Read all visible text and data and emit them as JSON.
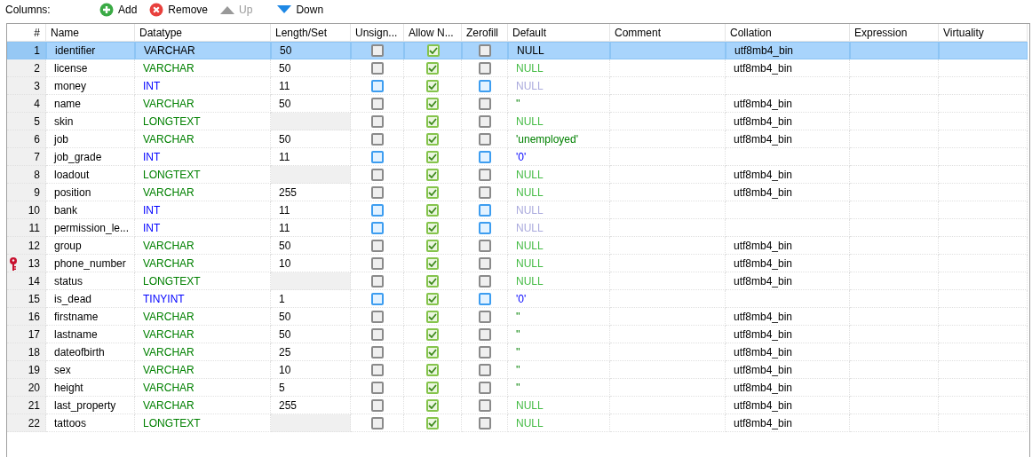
{
  "toolbar": {
    "label": "Columns:",
    "buttons": [
      {
        "kind": "add",
        "label": "Add",
        "disabled": false
      },
      {
        "kind": "remove",
        "label": "Remove",
        "disabled": false
      },
      {
        "kind": "up",
        "label": "Up",
        "disabled": true
      },
      {
        "kind": "down",
        "label": "Down",
        "disabled": false
      }
    ]
  },
  "table": {
    "columns": [
      "#",
      "Name",
      "Datatype",
      "Length/Set",
      "Unsign...",
      "Allow N...",
      "Zerofill",
      "Default",
      "Comment",
      "Collation",
      "Expression",
      "Virtuality"
    ],
    "rows": [
      {
        "num": "1",
        "name": "identifier",
        "datatype": {
          "text": "VARCHAR",
          "kind": "string"
        },
        "length": "50",
        "unsigned": false,
        "allow_null": true,
        "zerofill": false,
        "default": {
          "text": "NULL",
          "kind": "null"
        },
        "collation": "utf8mb4_bin",
        "key": false,
        "selected": true
      },
      {
        "num": "2",
        "name": "license",
        "datatype": {
          "text": "VARCHAR",
          "kind": "string"
        },
        "length": "50",
        "unsigned": false,
        "allow_null": true,
        "zerofill": false,
        "default": {
          "text": "NULL",
          "kind": "null"
        },
        "collation": "utf8mb4_bin",
        "key": false,
        "selected": false
      },
      {
        "num": "3",
        "name": "money",
        "datatype": {
          "text": "INT",
          "kind": "numeric"
        },
        "length": "11",
        "unsigned": false,
        "allow_null": true,
        "zerofill": false,
        "default": {
          "text": "NULL",
          "kind": "null"
        },
        "key": false,
        "selected": false
      },
      {
        "num": "4",
        "name": "name",
        "datatype": {
          "text": "VARCHAR",
          "kind": "string"
        },
        "length": "50",
        "unsigned": false,
        "allow_null": true,
        "zerofill": false,
        "default": {
          "text": "''",
          "kind": "value"
        },
        "collation": "utf8mb4_bin",
        "key": false,
        "selected": false
      },
      {
        "num": "5",
        "name": "skin",
        "datatype": {
          "text": "LONGTEXT",
          "kind": "string"
        },
        "unsigned": false,
        "allow_null": true,
        "zerofill": false,
        "default": {
          "text": "NULL",
          "kind": "null"
        },
        "collation": "utf8mb4_bin",
        "key": false,
        "selected": false
      },
      {
        "num": "6",
        "name": "job",
        "datatype": {
          "text": "VARCHAR",
          "kind": "string"
        },
        "length": "50",
        "unsigned": false,
        "allow_null": true,
        "zerofill": false,
        "default": {
          "text": "'unemployed'",
          "kind": "value"
        },
        "collation": "utf8mb4_bin",
        "key": false,
        "selected": false
      },
      {
        "num": "7",
        "name": "job_grade",
        "datatype": {
          "text": "INT",
          "kind": "numeric"
        },
        "length": "11",
        "unsigned": false,
        "allow_null": true,
        "zerofill": false,
        "default": {
          "text": "'0'",
          "kind": "value"
        },
        "key": false,
        "selected": false
      },
      {
        "num": "8",
        "name": "loadout",
        "datatype": {
          "text": "LONGTEXT",
          "kind": "string"
        },
        "unsigned": false,
        "allow_null": true,
        "zerofill": false,
        "default": {
          "text": "NULL",
          "kind": "null"
        },
        "collation": "utf8mb4_bin",
        "key": false,
        "selected": false
      },
      {
        "num": "9",
        "name": "position",
        "datatype": {
          "text": "VARCHAR",
          "kind": "string"
        },
        "length": "255",
        "unsigned": false,
        "allow_null": true,
        "zerofill": false,
        "default": {
          "text": "NULL",
          "kind": "null"
        },
        "collation": "utf8mb4_bin",
        "key": false,
        "selected": false
      },
      {
        "num": "10",
        "name": "bank",
        "datatype": {
          "text": "INT",
          "kind": "numeric"
        },
        "length": "11",
        "unsigned": false,
        "allow_null": true,
        "zerofill": false,
        "default": {
          "text": "NULL",
          "kind": "null"
        },
        "key": false,
        "selected": false
      },
      {
        "num": "11",
        "name": "permission_le...",
        "datatype": {
          "text": "INT",
          "kind": "numeric"
        },
        "length": "11",
        "unsigned": false,
        "allow_null": true,
        "zerofill": false,
        "default": {
          "text": "NULL",
          "kind": "null"
        },
        "key": false,
        "selected": false
      },
      {
        "num": "12",
        "name": "group",
        "datatype": {
          "text": "VARCHAR",
          "kind": "string"
        },
        "length": "50",
        "unsigned": false,
        "allow_null": true,
        "zerofill": false,
        "default": {
          "text": "NULL",
          "kind": "null"
        },
        "collation": "utf8mb4_bin",
        "key": false,
        "selected": false
      },
      {
        "num": "13",
        "name": "phone_number",
        "datatype": {
          "text": "VARCHAR",
          "kind": "string"
        },
        "length": "10",
        "unsigned": false,
        "allow_null": true,
        "zerofill": false,
        "default": {
          "text": "NULL",
          "kind": "null"
        },
        "collation": "utf8mb4_bin",
        "key": true,
        "selected": false
      },
      {
        "num": "14",
        "name": "status",
        "datatype": {
          "text": "LONGTEXT",
          "kind": "string"
        },
        "unsigned": false,
        "allow_null": true,
        "zerofill": false,
        "default": {
          "text": "NULL",
          "kind": "null"
        },
        "collation": "utf8mb4_bin",
        "key": false,
        "selected": false
      },
      {
        "num": "15",
        "name": "is_dead",
        "datatype": {
          "text": "TINYINT",
          "kind": "numeric"
        },
        "length": "1",
        "unsigned": false,
        "allow_null": true,
        "zerofill": false,
        "default": {
          "text": "'0'",
          "kind": "value"
        },
        "key": false,
        "selected": false
      },
      {
        "num": "16",
        "name": "firstname",
        "datatype": {
          "text": "VARCHAR",
          "kind": "string"
        },
        "length": "50",
        "unsigned": false,
        "allow_null": true,
        "zerofill": false,
        "default": {
          "text": "''",
          "kind": "value"
        },
        "collation": "utf8mb4_bin",
        "key": false,
        "selected": false
      },
      {
        "num": "17",
        "name": "lastname",
        "datatype": {
          "text": "VARCHAR",
          "kind": "string"
        },
        "length": "50",
        "unsigned": false,
        "allow_null": true,
        "zerofill": false,
        "default": {
          "text": "''",
          "kind": "value"
        },
        "collation": "utf8mb4_bin",
        "key": false,
        "selected": false
      },
      {
        "num": "18",
        "name": "dateofbirth",
        "datatype": {
          "text": "VARCHAR",
          "kind": "string"
        },
        "length": "25",
        "unsigned": false,
        "allow_null": true,
        "zerofill": false,
        "default": {
          "text": "''",
          "kind": "value"
        },
        "collation": "utf8mb4_bin",
        "key": false,
        "selected": false
      },
      {
        "num": "19",
        "name": "sex",
        "datatype": {
          "text": "VARCHAR",
          "kind": "string"
        },
        "length": "10",
        "unsigned": false,
        "allow_null": true,
        "zerofill": false,
        "default": {
          "text": "''",
          "kind": "value"
        },
        "collation": "utf8mb4_bin",
        "key": false,
        "selected": false
      },
      {
        "num": "20",
        "name": "height",
        "datatype": {
          "text": "VARCHAR",
          "kind": "string"
        },
        "length": "5",
        "unsigned": false,
        "allow_null": true,
        "zerofill": false,
        "default": {
          "text": "''",
          "kind": "value"
        },
        "collation": "utf8mb4_bin",
        "key": false,
        "selected": false
      },
      {
        "num": "21",
        "name": "last_property",
        "datatype": {
          "text": "VARCHAR",
          "kind": "string"
        },
        "length": "255",
        "unsigned": false,
        "allow_null": true,
        "zerofill": false,
        "default": {
          "text": "NULL",
          "kind": "null"
        },
        "collation": "utf8mb4_bin",
        "key": false,
        "selected": false
      },
      {
        "num": "22",
        "name": "tattoos",
        "datatype": {
          "text": "LONGTEXT",
          "kind": "string"
        },
        "unsigned": false,
        "allow_null": true,
        "zerofill": false,
        "default": {
          "text": "NULL",
          "kind": "null"
        },
        "collation": "utf8mb4_bin",
        "key": false,
        "selected": false
      }
    ]
  }
}
